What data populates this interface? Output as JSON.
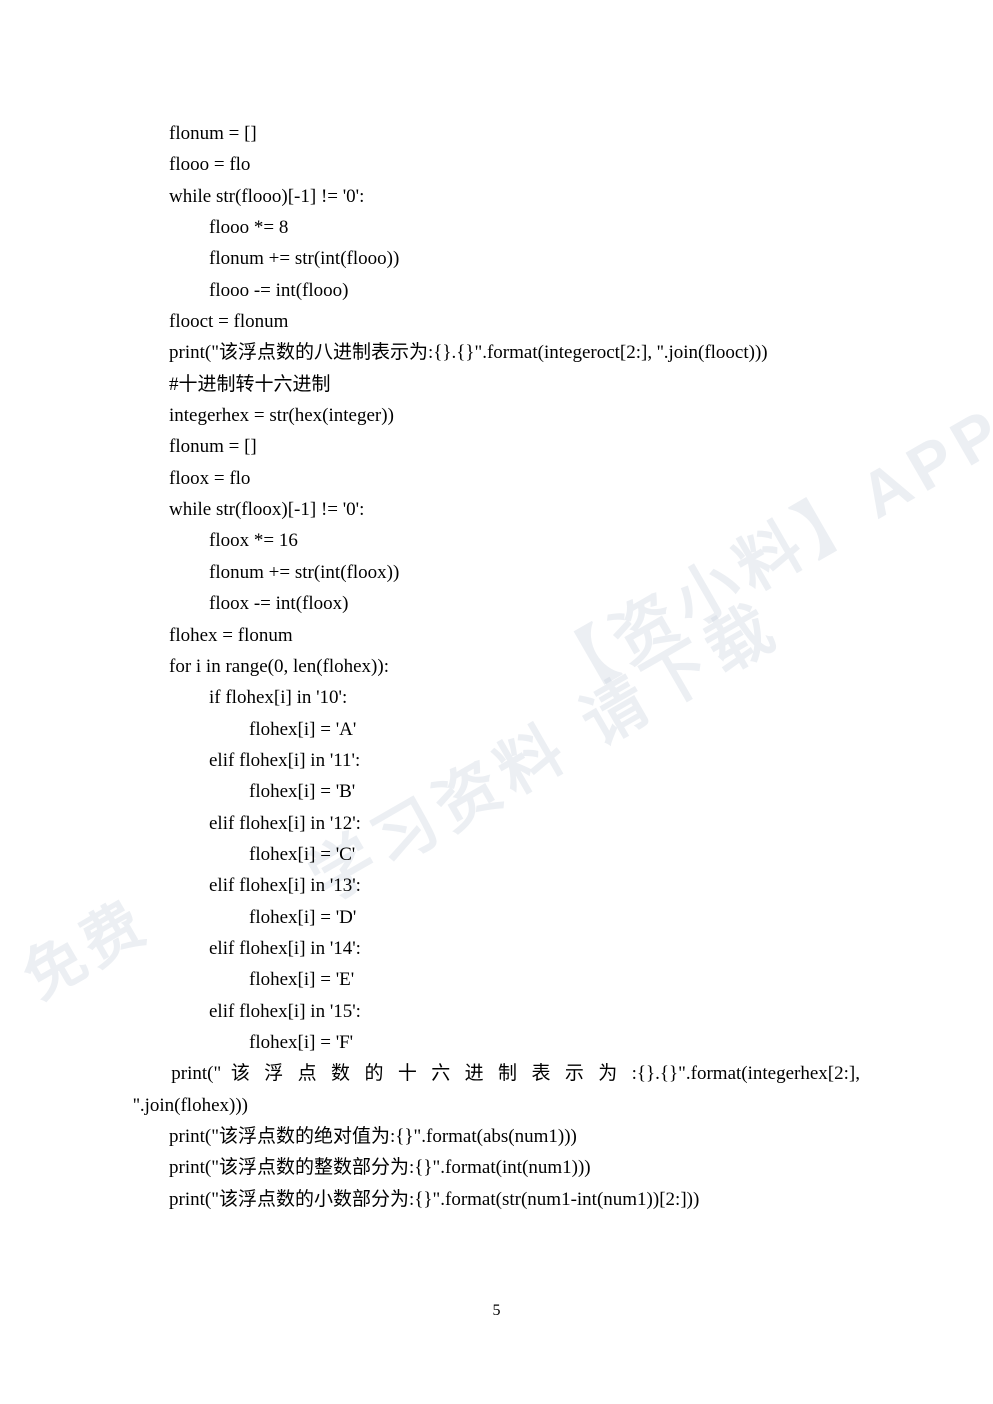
{
  "code": {
    "lines": [
      {
        "cls": "i1",
        "t": "flonum = []"
      },
      {
        "cls": "i1",
        "t": "flooo = flo"
      },
      {
        "cls": "i1",
        "t": "while str(flooo)[-1] != '0':"
      },
      {
        "cls": "i2",
        "t": "flooo *= 8"
      },
      {
        "cls": "i2",
        "t": "flonum += str(int(flooo))"
      },
      {
        "cls": "i2",
        "t": "flooo -= int(flooo)"
      },
      {
        "cls": "i1",
        "t": "flooct = flonum"
      },
      {
        "cls": "i1",
        "t": "print(\"该浮点数的八进制表示为:{}.{}\".format(integeroct[2:], ''.join(flooct)))"
      },
      {
        "cls": "i1",
        "t": "#十进制转十六进制"
      },
      {
        "cls": "i1",
        "t": "integerhex = str(hex(integer))"
      },
      {
        "cls": "i1",
        "t": "flonum = []"
      },
      {
        "cls": "i1",
        "t": "floox = flo"
      },
      {
        "cls": "i1",
        "t": "while str(floox)[-1] != '0':"
      },
      {
        "cls": "i2",
        "t": "floox *= 16"
      },
      {
        "cls": "i2",
        "t": "flonum += str(int(floox))"
      },
      {
        "cls": "i2",
        "t": "floox -= int(floox)"
      },
      {
        "cls": "i1",
        "t": "flohex = flonum"
      },
      {
        "cls": "i1",
        "t": "for i in range(0, len(flohex)):"
      },
      {
        "cls": "i2",
        "t": "if flohex[i] in '10':"
      },
      {
        "cls": "i3",
        "t": "flohex[i] = 'A'"
      },
      {
        "cls": "i2",
        "t": "elif flohex[i] in '11':"
      },
      {
        "cls": "i3",
        "t": "flohex[i] = 'B'"
      },
      {
        "cls": "i2",
        "t": "elif flohex[i] in '12':"
      },
      {
        "cls": "i3",
        "t": "flohex[i] = 'C'"
      },
      {
        "cls": "i2",
        "t": "elif flohex[i] in '13':"
      },
      {
        "cls": "i3",
        "t": "flohex[i] = 'D'"
      },
      {
        "cls": "i2",
        "t": "elif flohex[i] in '14':"
      },
      {
        "cls": "i3",
        "t": "flohex[i] = 'E'"
      },
      {
        "cls": "i2",
        "t": "elif flohex[i] in '15':"
      },
      {
        "cls": "i3",
        "t": "flohex[i] = 'F'"
      }
    ],
    "justified_line": "    print(\" 该 浮 点 数 的 十 六 进 制 表 示 为 :{}.{}\".format(integerhex[2:],",
    "wrap_line": "''.join(flohex)))",
    "tail": [
      {
        "cls": "i1",
        "t": "print(\"该浮点数的绝对值为:{}\".format(abs(num1)))"
      },
      {
        "cls": "i1",
        "t": "print(\"该浮点数的整数部分为:{}\".format(int(num1)))"
      },
      {
        "cls": "i1",
        "t": "print(\"该浮点数的小数部分为:{}\".format(str(num1-int(num1))[2:]))"
      }
    ]
  },
  "page_number": "5",
  "watermark": {
    "text1": "【资小料】APP",
    "text2": "学习资料  请下载",
    "text3": "免费"
  }
}
